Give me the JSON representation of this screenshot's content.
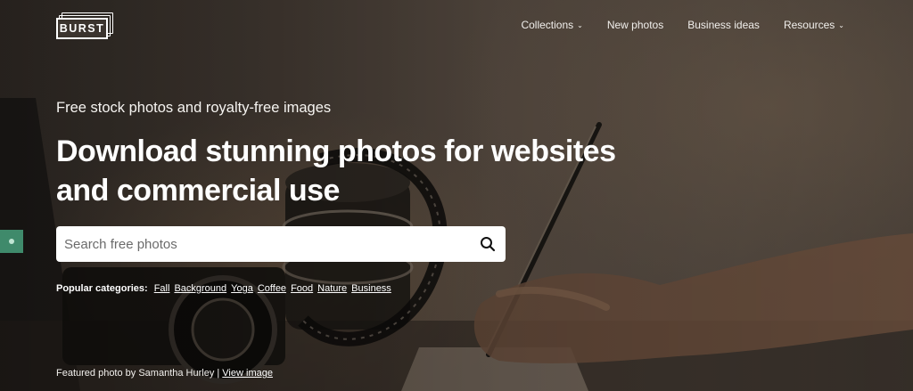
{
  "brand": {
    "logo_text": "BURST"
  },
  "nav": {
    "items": [
      {
        "label": "Collections",
        "has_dropdown": true
      },
      {
        "label": "New photos",
        "has_dropdown": false
      },
      {
        "label": "Business ideas",
        "has_dropdown": false
      },
      {
        "label": "Resources",
        "has_dropdown": true
      }
    ]
  },
  "hero": {
    "tagline": "Free stock photos and royalty-free images",
    "headline_line1": "Download stunning photos for websites",
    "headline_line2": "and commercial use"
  },
  "search": {
    "placeholder": "Search free photos",
    "value": "",
    "icon": "search-icon"
  },
  "popular": {
    "label": "Popular categories:",
    "categories": [
      "Fall",
      "Background",
      "Yoga",
      "Coffee",
      "Food",
      "Nature",
      "Business"
    ]
  },
  "featured": {
    "prefix": "Featured photo by Samantha Hurley | ",
    "link_label": "View image"
  },
  "colors": {
    "side_tab": "#3f8a6b",
    "search_bg": "#ffffff",
    "text": "#ffffff"
  }
}
